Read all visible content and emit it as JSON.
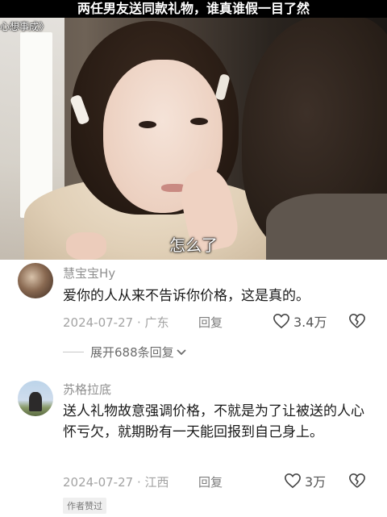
{
  "video": {
    "title": "两任男友送同款礼物，谁真谁假一目了然",
    "tag": "心想事成》",
    "subtitle": "怎么了"
  },
  "comments": [
    {
      "username": "慧宝宝Hy",
      "text": "爱你的人从来不告诉你价格，这是真的。",
      "date": "2024-07-27",
      "location": "· 广东",
      "reply_label": "回复",
      "likes": "3.4万"
    },
    {
      "username": "苏格拉底",
      "text": "送人礼物故意强调价格，不就是为了让被送的人心怀亏欠，就期盼有一天能回报到自己身上。",
      "date": "2024-07-27",
      "location": "· 江西",
      "reply_label": "回复",
      "likes": "3万",
      "badge": "作者赞过"
    }
  ],
  "expand_replies": "展开688条回复",
  "icons": {
    "like": "heart-outline-icon",
    "dislike": "broken-heart-icon",
    "expand": "chevron-down-icon"
  }
}
